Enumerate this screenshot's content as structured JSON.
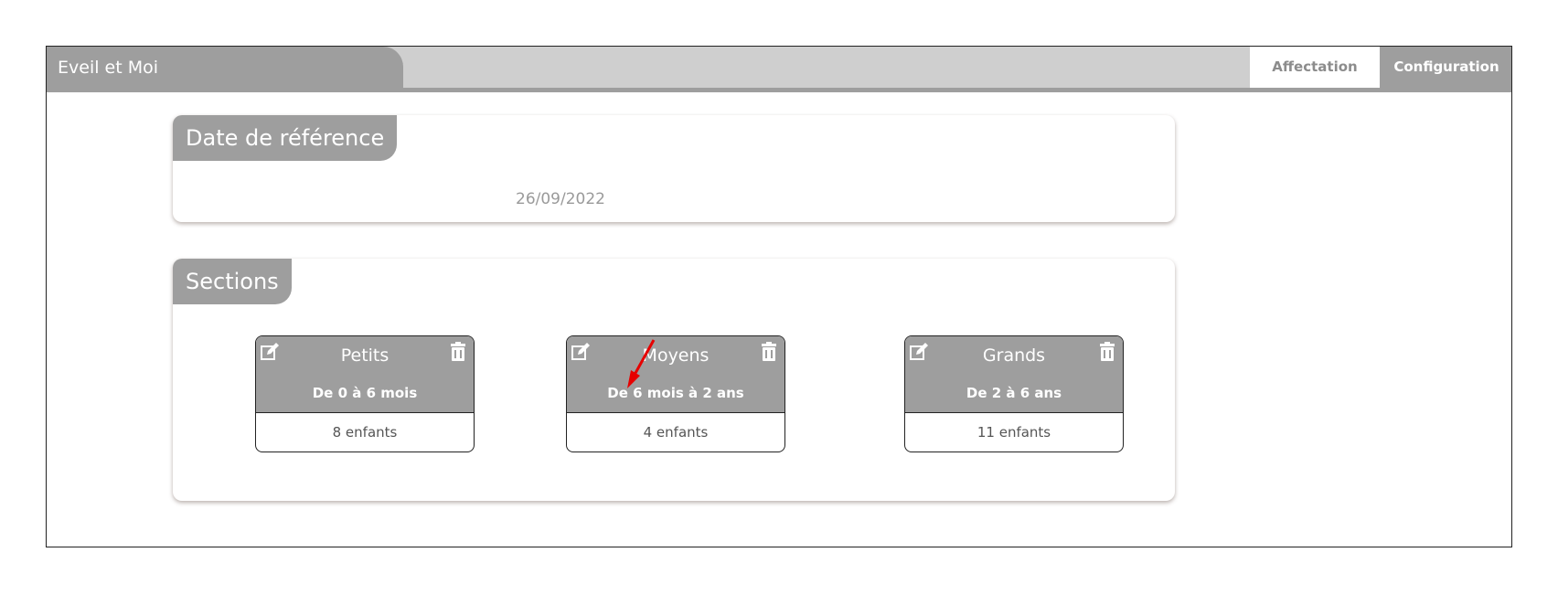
{
  "app": {
    "title": "Eveil et Moi"
  },
  "nav": {
    "tabs": [
      {
        "label": "Affectation"
      },
      {
        "label": "Configuration"
      }
    ]
  },
  "reference_date": {
    "label": "Date de référence",
    "value": "26/09/2022"
  },
  "sections": {
    "label": "Sections",
    "items": [
      {
        "name": "Petits",
        "range": "De 0 à 6 mois",
        "count": "8 enfants"
      },
      {
        "name": "Moyens",
        "range": "De 6 mois à 2 ans",
        "count": "4 enfants"
      },
      {
        "name": "Grands",
        "range": "De 2 à 6 ans",
        "count": "11 enfants"
      }
    ]
  },
  "icons": {
    "edit": "edit-icon",
    "delete": "trash-icon",
    "annotation": "red-arrow-icon"
  },
  "colors": {
    "header_gray": "#9e9e9e",
    "header_light": "#cfcfcf",
    "annotation_red": "#e60000"
  }
}
